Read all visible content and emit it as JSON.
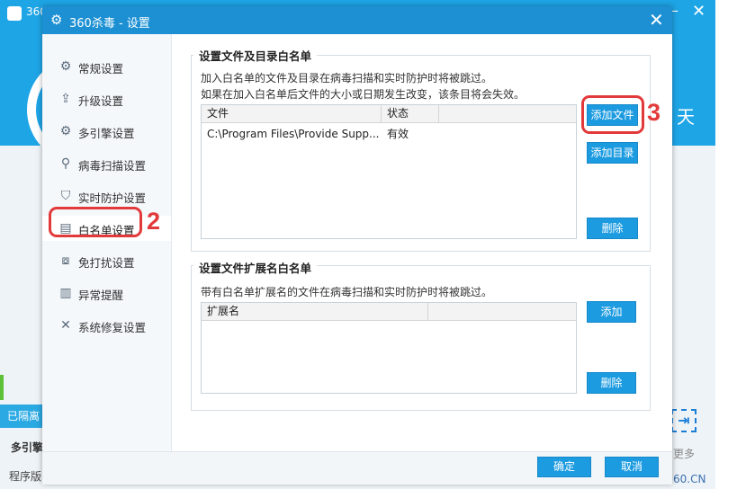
{
  "background_app": {
    "title": "360",
    "minimize_glyph": "—",
    "close_glyph": "✕",
    "day_char": "天",
    "quarantine_label": "已隔离",
    "engine_label": "多引擎",
    "version_label": "程序版",
    "arrow_glyph": "⇥",
    "more_label": "更多",
    "site_label": "60.CN"
  },
  "dialog": {
    "title": "360杀毒 - 设置",
    "close_glyph": "✕",
    "title_icon": "gear-icon"
  },
  "sidebar": {
    "items": [
      {
        "label": "常规设置",
        "icon": "gear-icon",
        "glyph": "⚙"
      },
      {
        "label": "升级设置",
        "icon": "upload-icon",
        "glyph": "⇪"
      },
      {
        "label": "多引擎设置",
        "icon": "engine-icon",
        "glyph": "⚙"
      },
      {
        "label": "病毒扫描设置",
        "icon": "search-icon",
        "glyph": "⚲"
      },
      {
        "label": "实时防护设置",
        "icon": "shield-icon",
        "glyph": "⛉"
      },
      {
        "label": "白名单设置",
        "icon": "document-icon",
        "glyph": "▤"
      },
      {
        "label": "免打扰设置",
        "icon": "do-not-disturb-icon",
        "glyph": "⧇"
      },
      {
        "label": "异常提醒",
        "icon": "bar-chart-icon",
        "glyph": "▥"
      },
      {
        "label": "系统修复设置",
        "icon": "wrench-icon",
        "glyph": "✕"
      }
    ],
    "active_index": 5
  },
  "annotations": {
    "step2": "2",
    "step3": "3",
    "color": "#e23a3a"
  },
  "file_whitelist": {
    "title": "设置文件及目录白名单",
    "desc1": "加入白名单的文件及目录在病毒扫描和实时防护时将被跳过。",
    "desc2": "如果在加入白名单后文件的大小或日期发生改变，该条目将会失效。",
    "columns": [
      "文件",
      "状态"
    ],
    "rows": [
      {
        "file": "C:\\Program Files\\Provide Supp...",
        "status": "有效"
      }
    ],
    "add_file_button": "添加文件",
    "add_dir_button": "添加目录",
    "delete_button": "删除"
  },
  "ext_whitelist": {
    "title": "设置文件扩展名白名单",
    "desc": "带有白名单扩展名的文件在病毒扫描和实时防护时将被跳过。",
    "columns": [
      "扩展名"
    ],
    "add_button": "添加",
    "delete_button": "删除"
  },
  "footer": {
    "ok_button": "确定",
    "cancel_button": "取消"
  },
  "colors": {
    "accent": "#1c9be0",
    "titlebar": "#1c90d3",
    "header": "#1ea5e6"
  }
}
